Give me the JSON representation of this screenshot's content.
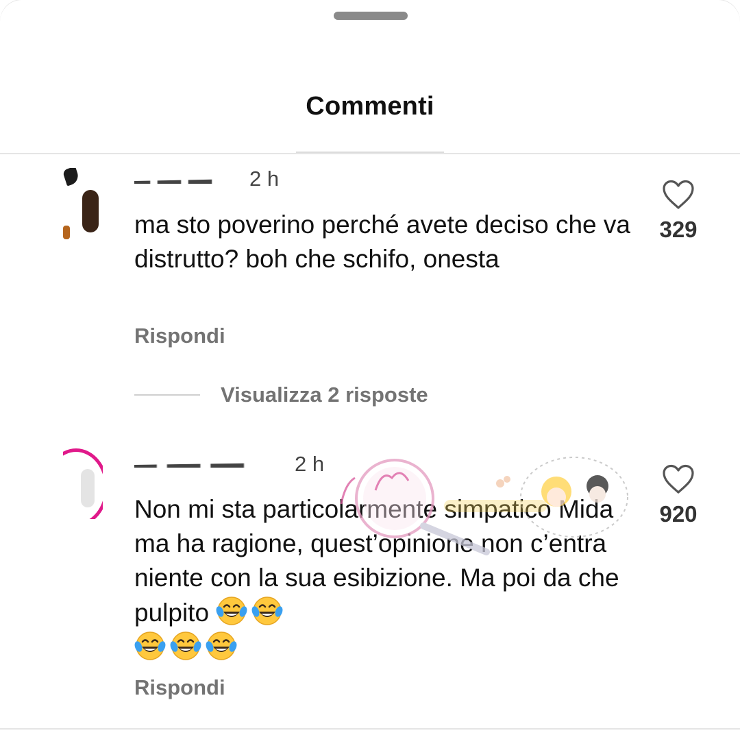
{
  "sheet": {
    "title": "Commenti"
  },
  "comments": [
    {
      "timestamp": "2 h",
      "text": "ma sto poverino perché avete deciso che va distrutto? boh che schifo, onesta",
      "reply_label": "Rispondi",
      "likes": "329"
    },
    {
      "timestamp": "2 h",
      "text": "Non mi sta particolarmente simpatico Mida ma ha ragione, quest’opinione non c’entra niente con la sua esibizione. Ma poi da che pulpito",
      "reply_label": "Rispondi",
      "likes": "920",
      "emoji_count": 5
    }
  ],
  "view_replies": {
    "label": "Visualizza 2 risposte"
  },
  "icons": {
    "like": "heart-icon",
    "emoji": "face-with-tears-of-joy-icon"
  },
  "colors": {
    "text": "#111111",
    "secondary": "#737373",
    "watermark": "#d9579b"
  }
}
